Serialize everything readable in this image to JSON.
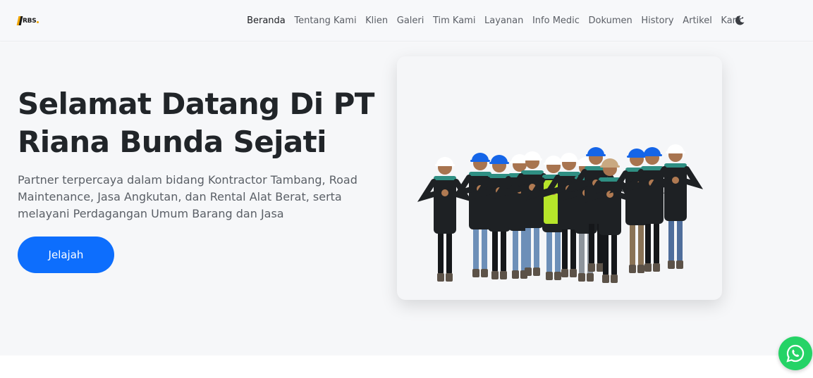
{
  "brand": {
    "logo_text": "RBS"
  },
  "nav": {
    "items": [
      {
        "label": "Beranda",
        "active": true
      },
      {
        "label": "Tentang Kami"
      },
      {
        "label": "Klien"
      },
      {
        "label": "Galeri"
      },
      {
        "label": "Tim Kami"
      },
      {
        "label": "Layanan"
      },
      {
        "label": "Info Medic"
      },
      {
        "label": "Dokumen"
      },
      {
        "label": "History"
      },
      {
        "label": "Artikel"
      },
      {
        "label": "Karir"
      }
    ],
    "theme_toggle_icon": "moon-icon"
  },
  "hero": {
    "title_line1": "Selamat Datang Di PT",
    "title_line2": "Riana Bunda Sejati",
    "subtitle": "Partner terpercaya dalam bidang Kontractor Tambang, Road Maintenance, Jasa Angkutan, dan Rental Alat Berat, serta melayani Perdagangan Umum Barang dan Jasa",
    "cta_label": "Jelajah",
    "image": "team-photo"
  },
  "floating": {
    "whatsapp_icon": "whatsapp-icon"
  },
  "colors": {
    "primary": "#0d6efd",
    "title": "#212529",
    "text": "#5a5f66",
    "hero_bg": "#f6f7f9",
    "whatsapp": "#25d366",
    "brand_accent": "#f0a500"
  }
}
